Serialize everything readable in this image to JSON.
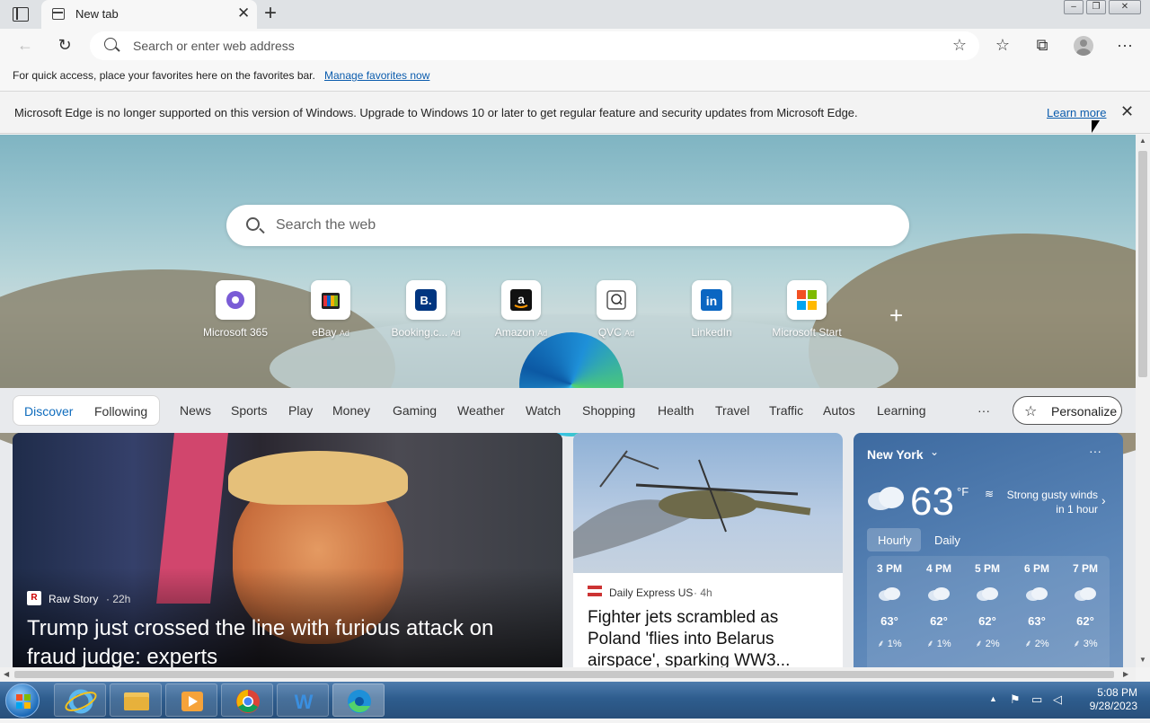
{
  "titlebar": {
    "tab_title": "New tab",
    "tab_close": "✕",
    "new_tab": "+",
    "window_buttons": [
      "‒",
      "❐",
      "✕"
    ]
  },
  "toolbar": {
    "back": "←",
    "refresh": "↻",
    "address_placeholder": "Search or enter web address",
    "add_favorite": "☆",
    "favorites": "☆",
    "collections": "⧉",
    "more": "···"
  },
  "favbar": {
    "text": "For quick access, place your favorites here on the favorites bar.",
    "link": "Manage favorites now"
  },
  "infobar": {
    "text": "Microsoft Edge is no longer supported on this version of Windows. Upgrade to Windows 10 or later to get regular feature and security updates from Microsoft Edge.",
    "link": "Learn more",
    "close": "✕"
  },
  "newtab": {
    "search_placeholder": "Search the web",
    "add_site": "+",
    "quick_links": [
      {
        "label": "Microsoft 365",
        "ad": ""
      },
      {
        "label": "eBay",
        "ad": "Ad"
      },
      {
        "label": "Booking.c...",
        "ad": "Ad"
      },
      {
        "label": "Amazon",
        "ad": "Ad"
      },
      {
        "label": "QVC",
        "ad": "Ad"
      },
      {
        "label": "LinkedIn",
        "ad": ""
      },
      {
        "label": "Microsoft Start",
        "ad": ""
      }
    ]
  },
  "feednav": {
    "discover": "Discover",
    "following": "Following",
    "items": [
      "News",
      "Sports",
      "Play",
      "Money",
      "Gaming",
      "Weather",
      "Watch",
      "Shopping",
      "Health",
      "Travel",
      "Traffic",
      "Autos",
      "Learning"
    ],
    "more": "···",
    "personalize": "Personalize"
  },
  "cards": {
    "main": {
      "source": "Raw Story",
      "age": "· 22h",
      "headline": "Trump just crossed the line with furious attack on fraud judge: experts"
    },
    "second": {
      "source": "Daily Express US",
      "age": "· 4h",
      "headline": "Fighter jets scrambled as Poland 'flies into Belarus airspace', sparking WW3..."
    }
  },
  "weather": {
    "location": "New York",
    "temp": "63",
    "unit": "°F",
    "alert": "Strong gusty winds in 1 hour",
    "tabs": [
      "Hourly",
      "Daily"
    ],
    "hours": [
      {
        "time": "3 PM",
        "temp": "63°",
        "precip": "1%"
      },
      {
        "time": "4 PM",
        "temp": "62°",
        "precip": "1%"
      },
      {
        "time": "5 PM",
        "temp": "62°",
        "precip": "2%"
      },
      {
        "time": "6 PM",
        "temp": "63°",
        "precip": "2%"
      },
      {
        "time": "7 PM",
        "temp": "62°",
        "precip": "3%"
      }
    ]
  },
  "taskbar": {
    "time": "5:08 PM",
    "date": "9/28/2023"
  }
}
